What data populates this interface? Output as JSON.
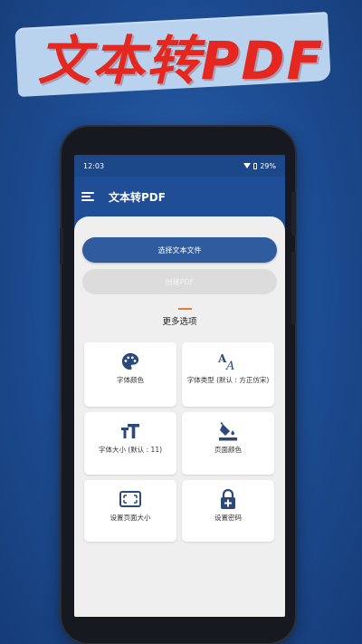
{
  "banner": {
    "title": "文本转PDF"
  },
  "status_bar": {
    "time": "12:03",
    "battery": "29%"
  },
  "app_bar": {
    "title": "文本转PDF",
    "menu_icon": "hamburger-menu-icon"
  },
  "actions": {
    "select_file": "选择文本文件",
    "create_pdf": "创建PDF"
  },
  "more_options": {
    "title": "更多选项",
    "items": [
      {
        "label": "字体颜色",
        "icon": "palette-icon"
      },
      {
        "label": "字体类型 (默认 : 方正仿宋)",
        "icon": "font-type-icon"
      },
      {
        "label": "字体大小 (默认 : 11)",
        "icon": "font-size-icon"
      },
      {
        "label": "页面颜色",
        "icon": "paint-bucket-icon"
      },
      {
        "label": "设置页面大小",
        "icon": "page-size-icon"
      },
      {
        "label": "设置密码",
        "icon": "lock-plus-icon"
      }
    ]
  },
  "colors": {
    "primary": "#2e5c9f",
    "background": "#1f4e96",
    "accent_line": "#e77c2c",
    "banner_text": "#e4281f",
    "icon": "#2b4a7a"
  }
}
